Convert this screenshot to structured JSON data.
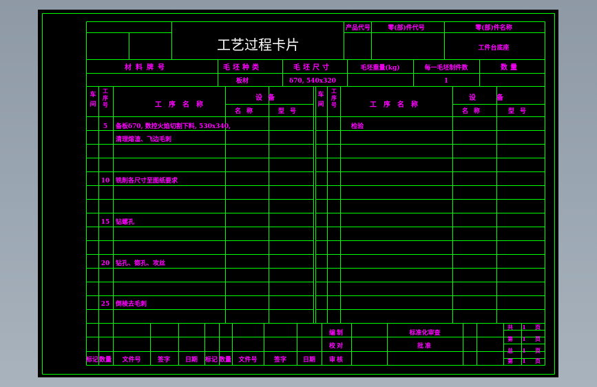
{
  "card": {
    "title": "工艺过程卡片",
    "product_code_label": "产品代号",
    "part_code_label": "零(部)件代号",
    "part_name_label": "零(部)件名称",
    "part_name_value": "工件台底座",
    "material_label": "材料牌号",
    "blank_type_label": "毛坯种类",
    "blank_type_value": "板材",
    "blank_size_label": "毛坯尺寸",
    "blank_size_value": "δ70, 540x320",
    "blank_weight_label": "毛坯重量(kg)",
    "parts_per_blank_label": "每一毛坯制件数",
    "parts_per_blank_value": "1",
    "quantity_label": "数量"
  },
  "columns": {
    "workshop": "车间",
    "op_no": "工序号",
    "op_name": "工序名称",
    "equipment": "设备",
    "eq_name": "名称",
    "eq_model": "型号"
  },
  "operations": [
    {
      "no": "5",
      "lines": [
        "备板δ70, 数控火焰切割下料, 530x340,",
        "清理熔渣、飞边毛刺"
      ]
    },
    {
      "no": "10",
      "lines": [
        "铣削各尺寸至图纸要求"
      ]
    },
    {
      "no": "15",
      "lines": [
        "钻螺孔"
      ]
    },
    {
      "no": "20",
      "lines": [
        "钻孔、锪孔、攻丝"
      ]
    },
    {
      "no": "25",
      "lines": [
        "倒棱去毛刺"
      ]
    }
  ],
  "right_ops": [
    {
      "lines": [
        "检验"
      ]
    }
  ],
  "footer": {
    "compile": "编制",
    "proofread": "校对",
    "review": "审核",
    "standardize": "标准化审查",
    "approve": "批准",
    "sheet_total": "共",
    "sheet_no": "第",
    "volume_total": "总",
    "volume_no": "第",
    "page_unit": "页",
    "sheet_count": "1",
    "headers": [
      "标记",
      "数量",
      "文件号",
      "签字",
      "日期",
      "标记",
      "数量",
      "文件号",
      "签字",
      "日期"
    ]
  }
}
